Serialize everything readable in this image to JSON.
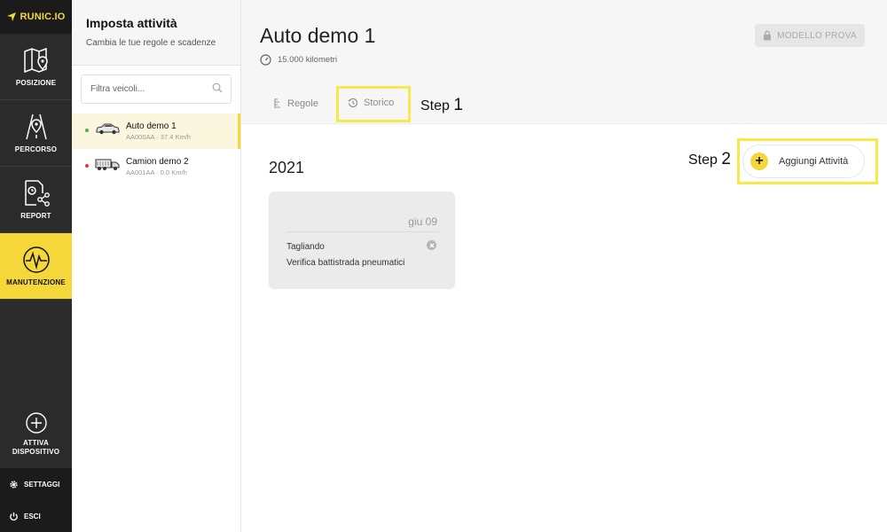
{
  "brand": {
    "logo_text": "RUNIC.IO",
    "accent": "#f5d73a"
  },
  "nav": {
    "posizione": "POSIZIONE",
    "percorso": "PERCORSO",
    "report": "REPORT",
    "manutenzione": "MANUTENZIONE",
    "attiva_line1": "ATTIVA",
    "attiva_line2": "DISPOSITIVO",
    "settaggi": "SETTAGGI",
    "esci": "ESCI"
  },
  "panel": {
    "title": "Imposta attività",
    "subtitle": "Cambia le tue regole e scadenze",
    "filter_placeholder": "Filtra veicoli..."
  },
  "vehicles": [
    {
      "name": "Auto demo 1",
      "meta": "AA000AA · 37.4 Km/h",
      "status_color": "#4caf50",
      "icon": "car-icon"
    },
    {
      "name": "Camion demo 2",
      "meta": "AA001AA · 0.0 Km/h",
      "status_color": "#e53935",
      "icon": "truck-icon"
    }
  ],
  "main": {
    "title": "Auto demo 1",
    "km": "15.000 kilometri",
    "demo_button": "MODELLO PROVA",
    "tabs": {
      "regole": "Regole",
      "storico": "Storico"
    },
    "step1_word": "Step",
    "step1_num": "1",
    "step2_word": "Step",
    "step2_num": "2",
    "year": "2021",
    "add_button": "Aggiungi Attività"
  },
  "cards": [
    {
      "date": "giu 09",
      "line1": "Tagliando",
      "line2": "Verifica battistrada pneumatici"
    }
  ]
}
